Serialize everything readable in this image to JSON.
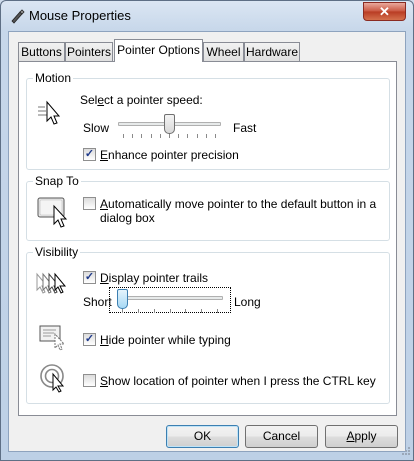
{
  "window": {
    "title": "Mouse Properties",
    "close_label": "✕"
  },
  "tabs": [
    {
      "label": "Buttons"
    },
    {
      "label": "Pointers"
    },
    {
      "label": "Pointer Options"
    },
    {
      "label": "Wheel"
    },
    {
      "label": "Hardware"
    }
  ],
  "active_tab": "Pointer Options",
  "motion": {
    "group_label": "Motion",
    "speed_label_pre": "Sel",
    "speed_label_key": "e",
    "speed_label_post": "ct a pointer speed:",
    "slow_label": "Slow",
    "fast_label": "Fast",
    "speed_level": 0.5,
    "precision_checked": true,
    "precision_key": "E",
    "precision_label": "nhance pointer precision"
  },
  "snap_to": {
    "group_label": "Snap To",
    "snap_checked": false,
    "snap_key": "A",
    "snap_label_line1": "utomatically move pointer to the default button in a",
    "snap_label_line2": "dialog box"
  },
  "visibility": {
    "group_label": "Visibility",
    "trails_checked": true,
    "trails_key": "D",
    "trails_label": "isplay pointer trails",
    "short_label": "Short",
    "long_label": "Long",
    "trail_length_level": 0.0,
    "hide_checked": true,
    "hide_key": "H",
    "hide_label": "ide pointer while typing",
    "show_checked": false,
    "show_key": "S",
    "show_label": "how location of pointer when I press the CTRL key"
  },
  "buttons": {
    "ok_label": "OK",
    "cancel_label": "Cancel",
    "apply_key": "A",
    "apply_label": "pply"
  },
  "colors": {
    "accent": "#3c7fb1",
    "close_red": "#c9553f",
    "check_mark": "#1f3a8a"
  }
}
